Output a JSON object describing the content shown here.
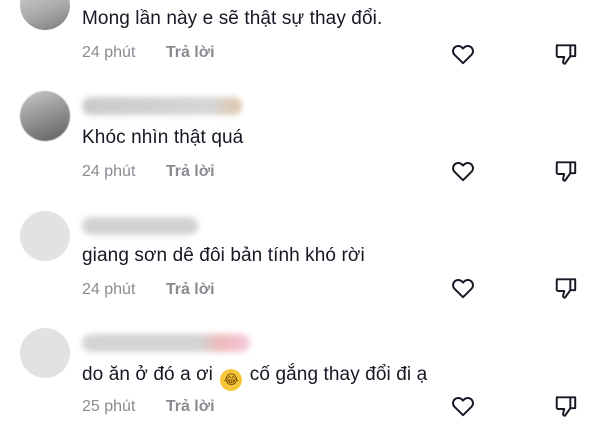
{
  "comments": [
    {
      "text": "Mong lần này e sẽ thật sự thay đổi.",
      "time": "24 phút",
      "reply": "Trả lời"
    },
    {
      "text": "Khóc nhìn thật quá",
      "time": "24 phút",
      "reply": "Trả lời"
    },
    {
      "text": "giang sơn dê đôi bản tính khó rời",
      "time": "24 phút",
      "reply": "Trả lời"
    },
    {
      "text_before_emoji": "do ăn ở đó a ơi",
      "emoji": "😂",
      "text_after_emoji": "cố gắng thay đổi đi ạ",
      "time": "25 phút",
      "reply": "Trả lời"
    }
  ],
  "icons": {
    "like": "heart-outline-icon",
    "dislike": "thumbs-down-outline-icon"
  },
  "colors": {
    "text": "#161823",
    "meta": "#8a8b91",
    "avatar_placeholder": "#e2e2e4"
  }
}
